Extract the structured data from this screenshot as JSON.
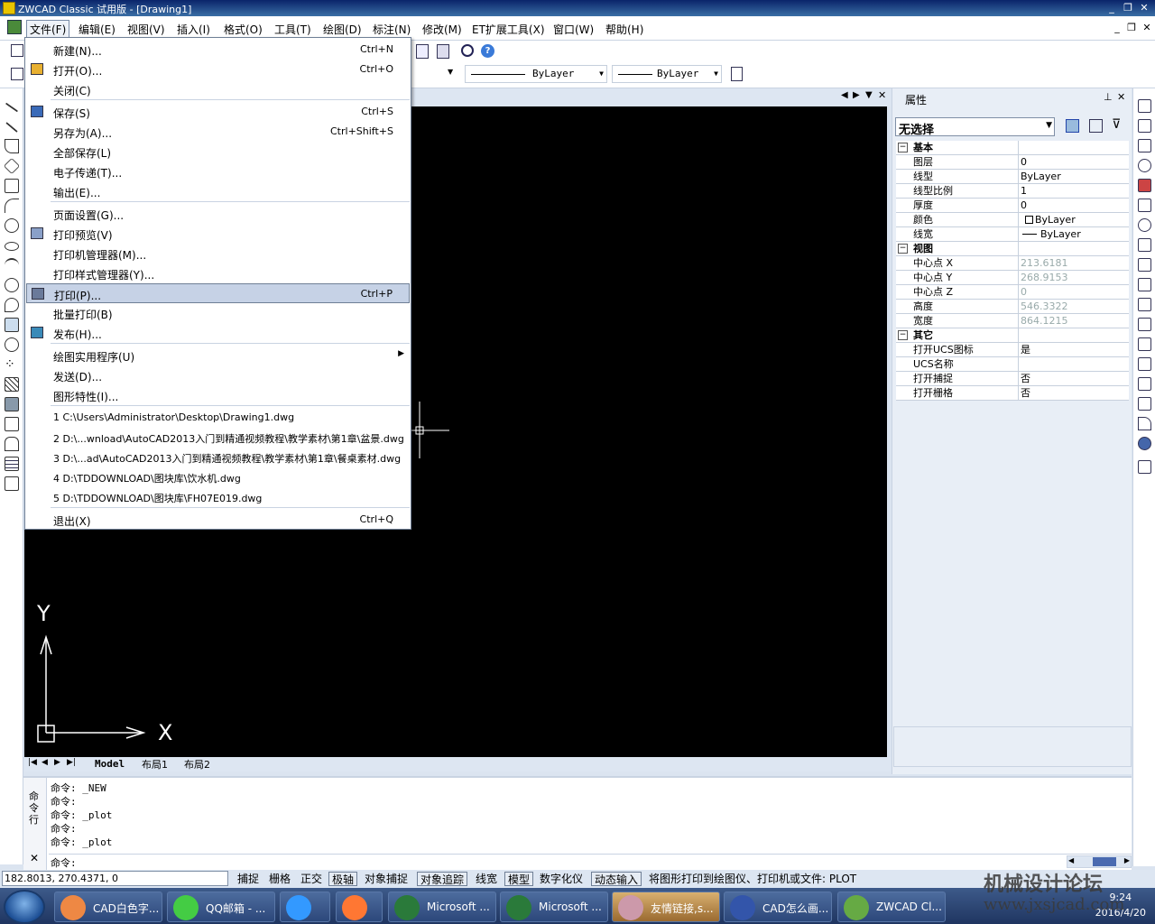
{
  "window": {
    "title": "ZWCAD Classic 试用版 - [Drawing1]"
  },
  "menubar": [
    "文件(F)",
    "编辑(E)",
    "视图(V)",
    "插入(I)",
    "格式(O)",
    "工具(T)",
    "绘图(D)",
    "标注(N)",
    "修改(M)",
    "ET扩展工具(X)",
    "窗口(W)",
    "帮助(H)"
  ],
  "toolbar": {
    "linetype_value": "ByLayer",
    "lineweight_value": "ByLayer"
  },
  "file_menu": {
    "items": [
      {
        "label": "新建(N)...",
        "shortcut": "Ctrl+N"
      },
      {
        "label": "打开(O)...",
        "shortcut": "Ctrl+O"
      },
      {
        "label": "关闭(C)",
        "shortcut": ""
      },
      {
        "label": "保存(S)",
        "shortcut": "Ctrl+S"
      },
      {
        "label": "另存为(A)...",
        "shortcut": "Ctrl+Shift+S"
      },
      {
        "label": "全部保存(L)",
        "shortcut": ""
      },
      {
        "label": "电子传递(T)...",
        "shortcut": ""
      },
      {
        "label": "输出(E)...",
        "shortcut": ""
      },
      {
        "label": "页面设置(G)...",
        "shortcut": ""
      },
      {
        "label": "打印预览(V)",
        "shortcut": ""
      },
      {
        "label": "打印机管理器(M)...",
        "shortcut": ""
      },
      {
        "label": "打印样式管理器(Y)...",
        "shortcut": ""
      },
      {
        "label": "打印(P)...",
        "shortcut": "Ctrl+P"
      },
      {
        "label": "批量打印(B)",
        "shortcut": ""
      },
      {
        "label": "发布(H)...",
        "shortcut": ""
      },
      {
        "label": "绘图实用程序(U)",
        "shortcut": ""
      },
      {
        "label": "发送(D)...",
        "shortcut": ""
      },
      {
        "label": "图形特性(I)...",
        "shortcut": ""
      },
      {
        "label": "1 C:\\Users\\Administrator\\Desktop\\Drawing1.dwg",
        "shortcut": ""
      },
      {
        "label": "2 D:\\...wnload\\AutoCAD2013入门到精通视频教程\\教学素材\\第1章\\盆景.dwg",
        "shortcut": ""
      },
      {
        "label": "3 D:\\...ad\\AutoCAD2013入门到精通视频教程\\教学素材\\第1章\\餐桌素材.dwg",
        "shortcut": ""
      },
      {
        "label": "4 D:\\TDDOWNLOAD\\图块库\\饮水机.dwg",
        "shortcut": ""
      },
      {
        "label": "5 D:\\TDDOWNLOAD\\图块库\\FH07E019.dwg",
        "shortcut": ""
      },
      {
        "label": "退出(X)",
        "shortcut": "Ctrl+Q"
      }
    ]
  },
  "canvas": {
    "axis_y": "Y",
    "axis_x": "X"
  },
  "layout_tabs": [
    "Model",
    "布局1",
    "布局2"
  ],
  "properties": {
    "title": "属性",
    "selection": "无选择",
    "groups": [
      {
        "name": "基本",
        "rows": [
          {
            "k": "图层",
            "v": "0"
          },
          {
            "k": "线型",
            "v": "ByLayer"
          },
          {
            "k": "线型比例",
            "v": "1"
          },
          {
            "k": "厚度",
            "v": "0"
          },
          {
            "k": "颜色",
            "v": "ByLayer"
          },
          {
            "k": "线宽",
            "v": "ByLayer"
          }
        ]
      },
      {
        "name": "视图",
        "rows": [
          {
            "k": "中心点 X",
            "v": "213.6181"
          },
          {
            "k": "中心点 Y",
            "v": "268.9153"
          },
          {
            "k": "中心点 Z",
            "v": "0"
          },
          {
            "k": "高度",
            "v": "546.3322"
          },
          {
            "k": "宽度",
            "v": "864.1215"
          }
        ]
      },
      {
        "name": "其它",
        "rows": [
          {
            "k": "打开UCS图标",
            "v": "是"
          },
          {
            "k": "UCS名称",
            "v": ""
          },
          {
            "k": "打开捕捉",
            "v": "否"
          },
          {
            "k": "打开栅格",
            "v": "否"
          }
        ]
      }
    ]
  },
  "command": {
    "side_label": "命令行",
    "lines": [
      "命令: _NEW",
      "命令:",
      "命令: _plot",
      "命令:",
      "命令: _plot"
    ],
    "prompt": "命令:"
  },
  "status": {
    "coords": "182.8013,  270.4371,  0",
    "toggles": [
      "捕捉",
      "栅格",
      "正交",
      "极轴",
      "对象捕捉",
      "对象追踪",
      "线宽",
      "模型",
      "数字化仪",
      "动态输入"
    ],
    "message": "将图形打印到绘图仪、打印机或文件: PLOT"
  },
  "taskbar": {
    "items": [
      "CAD白色字...",
      "QQ邮箱 - ...",
      "",
      "",
      "Microsoft ...",
      "Microsoft ...",
      "友情链接,s...",
      "CAD怎么画...",
      "ZWCAD Cl..."
    ],
    "time": "9:24",
    "date": "2016/4/20"
  },
  "watermark": {
    "line1": "机械设计论坛",
    "line2": "www.jxsjcad.com"
  }
}
